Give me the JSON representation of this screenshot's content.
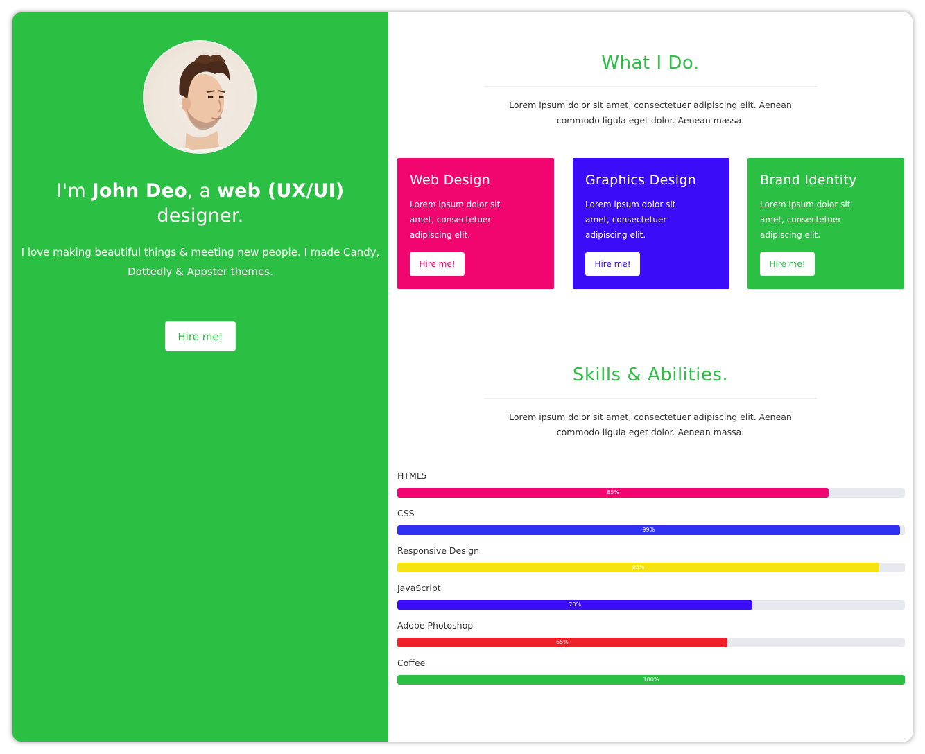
{
  "left": {
    "headline_pre": "I'm ",
    "headline_name": "John Deo",
    "headline_mid": ", a ",
    "headline_role": "web (UX/UI)",
    "headline_post": " designer.",
    "intro": "I love making beautiful things & meeting new people. I made Candy, Dottedly & Appster themes.",
    "hire_label": "Hire me!",
    "accent": "#2bbf43"
  },
  "what": {
    "title": "What I Do.",
    "lead": "Lorem ipsum dolor sit amet, consectetuer adipiscing elit. Aenean commodo ligula eget dolor. Aenean massa.",
    "cards": [
      {
        "title": "Web Design",
        "text": "Lorem ipsum dolor sit amet, consectetuer adipiscing elit.",
        "button": "Hire me!",
        "color": "#f0066e"
      },
      {
        "title": "Graphics Design",
        "text": "Lorem ipsum dolor sit amet, consectetuer adipiscing elit.",
        "button": "Hire me!",
        "color": "#3a0cf7"
      },
      {
        "title": "Brand Identity",
        "text": "Lorem ipsum dolor sit amet, consectetuer adipiscing elit.",
        "button": "Hire me!",
        "color": "#2bbf43"
      }
    ]
  },
  "skills": {
    "title": "Skills & Abilities.",
    "lead": "Lorem ipsum dolor sit amet, consectetuer adipiscing elit. Aenean commodo ligula eget dolor. Aenean massa.",
    "items": [
      {
        "name": "HTML5",
        "percent": 85,
        "label": "85%",
        "color": "#f0066e"
      },
      {
        "name": "CSS",
        "percent": 99,
        "label": "99%",
        "color": "#3030f0"
      },
      {
        "name": "Responsive Design",
        "percent": 95,
        "label": "95%",
        "color": "#f6e312"
      },
      {
        "name": "JavaScript",
        "percent": 70,
        "label": "70%",
        "color": "#3a0cf7"
      },
      {
        "name": "Adobe Photoshop",
        "percent": 65,
        "label": "65%",
        "color": "#f0202a"
      },
      {
        "name": "Coffee",
        "percent": 100,
        "label": "100%",
        "color": "#2bbf43"
      }
    ]
  }
}
